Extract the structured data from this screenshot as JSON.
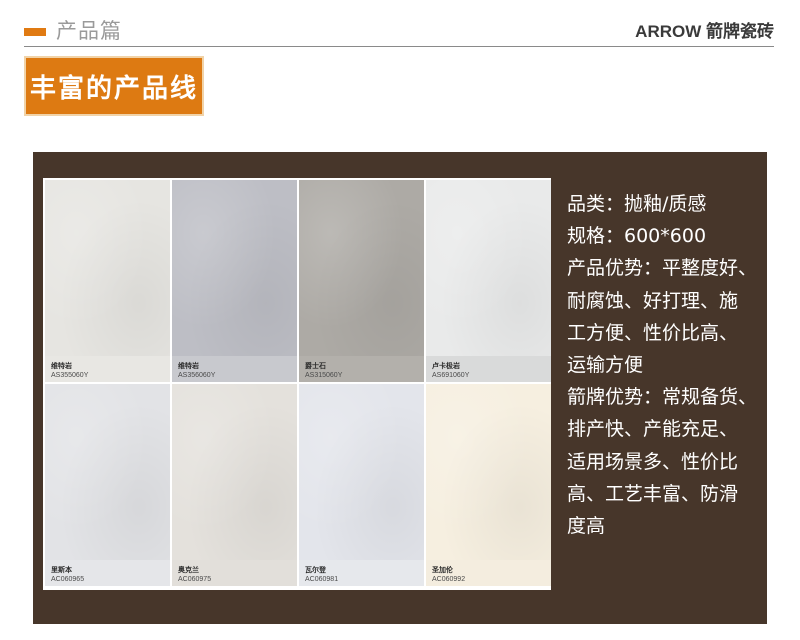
{
  "header": {
    "section_label": "产品篇",
    "brand": "ARROW 箭牌瓷砖",
    "accent_color": "#e07a12"
  },
  "title": "丰富的产品线",
  "products": [
    {
      "name": "维特岩",
      "code": "AS355060Y",
      "swatch": "#e6e5e1",
      "caption_bg": "#e8e7e3"
    },
    {
      "name": "维特岩",
      "code": "AS356060Y",
      "swatch": "#bdbec5",
      "caption_bg": "#c8c9ce"
    },
    {
      "name": "爵士石",
      "code": "AS315060Y",
      "swatch": "#adaaa5",
      "caption_bg": "#b3b0ab"
    },
    {
      "name": "卢卡极岩",
      "code": "AS691060Y",
      "swatch": "#e9eaea",
      "caption_bg": "#d9dada"
    },
    {
      "name": "里斯本",
      "code": "AC060965",
      "swatch": "#e2e3e6",
      "caption_bg": "#e5e6e9"
    },
    {
      "name": "奥克兰",
      "code": "AC060975",
      "swatch": "#e4e1dc",
      "caption_bg": "#e2dfda"
    },
    {
      "name": "瓦尔登",
      "code": "AC060981",
      "swatch": "#e3e5eb",
      "caption_bg": "#e6e8ec"
    },
    {
      "name": "圣加伦",
      "code": "AC060992",
      "swatch": "#f6efe0",
      "caption_bg": "#f4eddf"
    }
  ],
  "info_lines": [
    "品类：抛釉/质感",
    "规格：600*600",
    "产品优势：平整度好、",
    "耐腐蚀、好打理、施",
    "工方便、性价比高、",
    "运输方便",
    "箭牌优势：常规备货、",
    "排产快、产能充足、",
    "适用场景多、性价比",
    "高、工艺丰富、防滑",
    "度高"
  ],
  "colors": {
    "panel_bg": "#47362a",
    "title_bg": "#dd7a12"
  }
}
